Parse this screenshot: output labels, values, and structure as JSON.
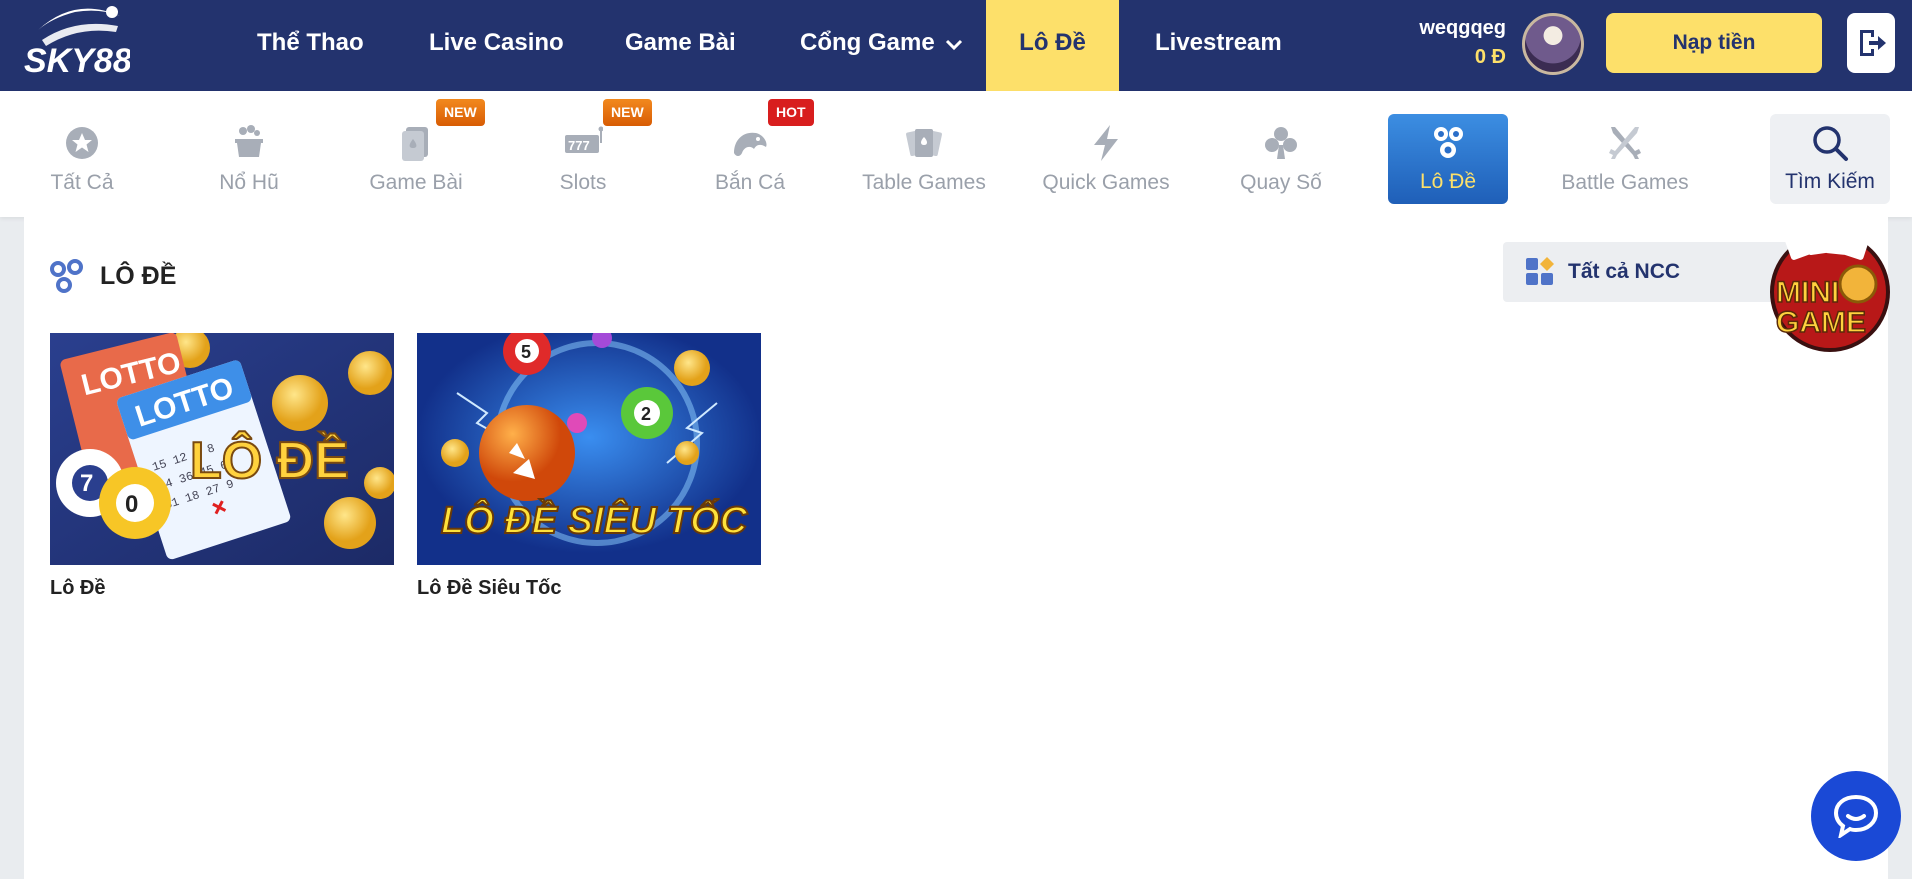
{
  "brand": {
    "logo_text": "SKY88",
    "accent": "#fde06a",
    "navy": "#23336e"
  },
  "nav": {
    "items": [
      {
        "label": "Thể Thao"
      },
      {
        "label": "Live Casino"
      },
      {
        "label": "Game Bài"
      },
      {
        "label": "Cổng Game",
        "has_dropdown": true
      },
      {
        "label": "Lô Đề",
        "active": true
      },
      {
        "label": "Livestream"
      }
    ]
  },
  "user": {
    "name": "weqgqeg",
    "balance": "0 Đ",
    "deposit_label": "Nạp tiền"
  },
  "categories": [
    {
      "label": "Tất Cả",
      "icon": "star-icon"
    },
    {
      "label": "Nổ Hũ",
      "icon": "jackpot-pot-icon"
    },
    {
      "label": "Game Bài",
      "icon": "cards-icon",
      "badge": "NEW"
    },
    {
      "label": "Slots",
      "icon": "slot-machine-icon",
      "badge": "NEW"
    },
    {
      "label": "Bắn Cá",
      "icon": "fish-icon",
      "badge": "HOT"
    },
    {
      "label": "Table Games",
      "icon": "table-cards-icon"
    },
    {
      "label": "Quick Games",
      "icon": "lightning-icon"
    },
    {
      "label": "Quay Số",
      "icon": "clubs-icon"
    },
    {
      "label": "Lô Đề",
      "icon": "lottery-balls-icon",
      "active": true
    },
    {
      "label": "Battle Games",
      "icon": "crossed-swords-icon"
    },
    {
      "label": "Tìm Kiếm",
      "icon": "search-icon"
    }
  ],
  "section": {
    "title": "LÔ ĐỀ",
    "provider_filter": "Tất cả NCC"
  },
  "games": [
    {
      "name": "Lô Đề",
      "banner_text": "LÔ ĐỀ",
      "ticket_text": "LOTTO"
    },
    {
      "name": "Lô Đề Siêu Tốc",
      "banner_text": "LÔ ĐỀ SIÊU TỐC"
    }
  ],
  "minigame": {
    "line1": "MINI",
    "line2": "GAME"
  }
}
